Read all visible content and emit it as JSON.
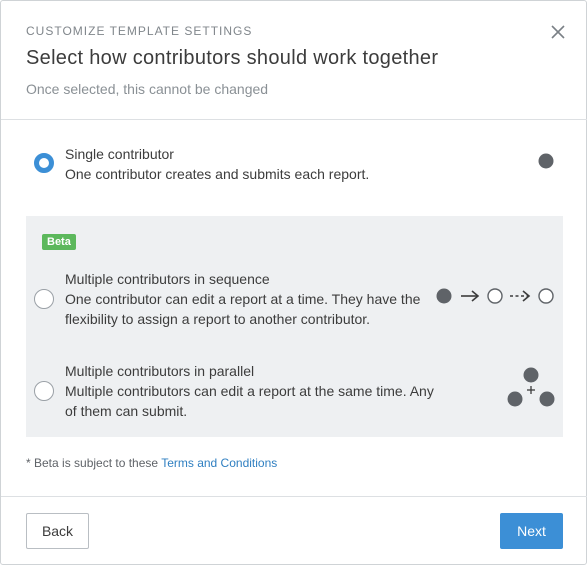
{
  "header": {
    "eyebrow": "CUSTOMIZE TEMPLATE SETTINGS",
    "title": "Select how contributors should work together",
    "subtitle": "Once selected, this cannot be changed"
  },
  "options": [
    {
      "title": "Single contributor",
      "description": "One contributor creates and submits each report.",
      "selected": true,
      "icon": "single-dot-icon"
    },
    {
      "title": "Multiple contributors in sequence",
      "description": "One contributor can edit a report at a time. They have the flexibility to assign a report to another contributor.",
      "selected": false,
      "icon": "sequence-flow-icon"
    },
    {
      "title": "Multiple contributors in parallel",
      "description": "Multiple contributors can edit a report at the same time. Any of them can submit.",
      "selected": false,
      "icon": "parallel-dots-icon"
    }
  ],
  "beta": {
    "badge": "Beta"
  },
  "footnote": {
    "prefix": "* Beta is subject to these ",
    "link": "Terms and Conditions"
  },
  "footer": {
    "back_label": "Back",
    "next_label": "Next"
  },
  "colors": {
    "accent": "#3c8fd6",
    "beta_badge": "#5cb85c",
    "link": "#2f7fc1",
    "dot": "#5f6368"
  }
}
